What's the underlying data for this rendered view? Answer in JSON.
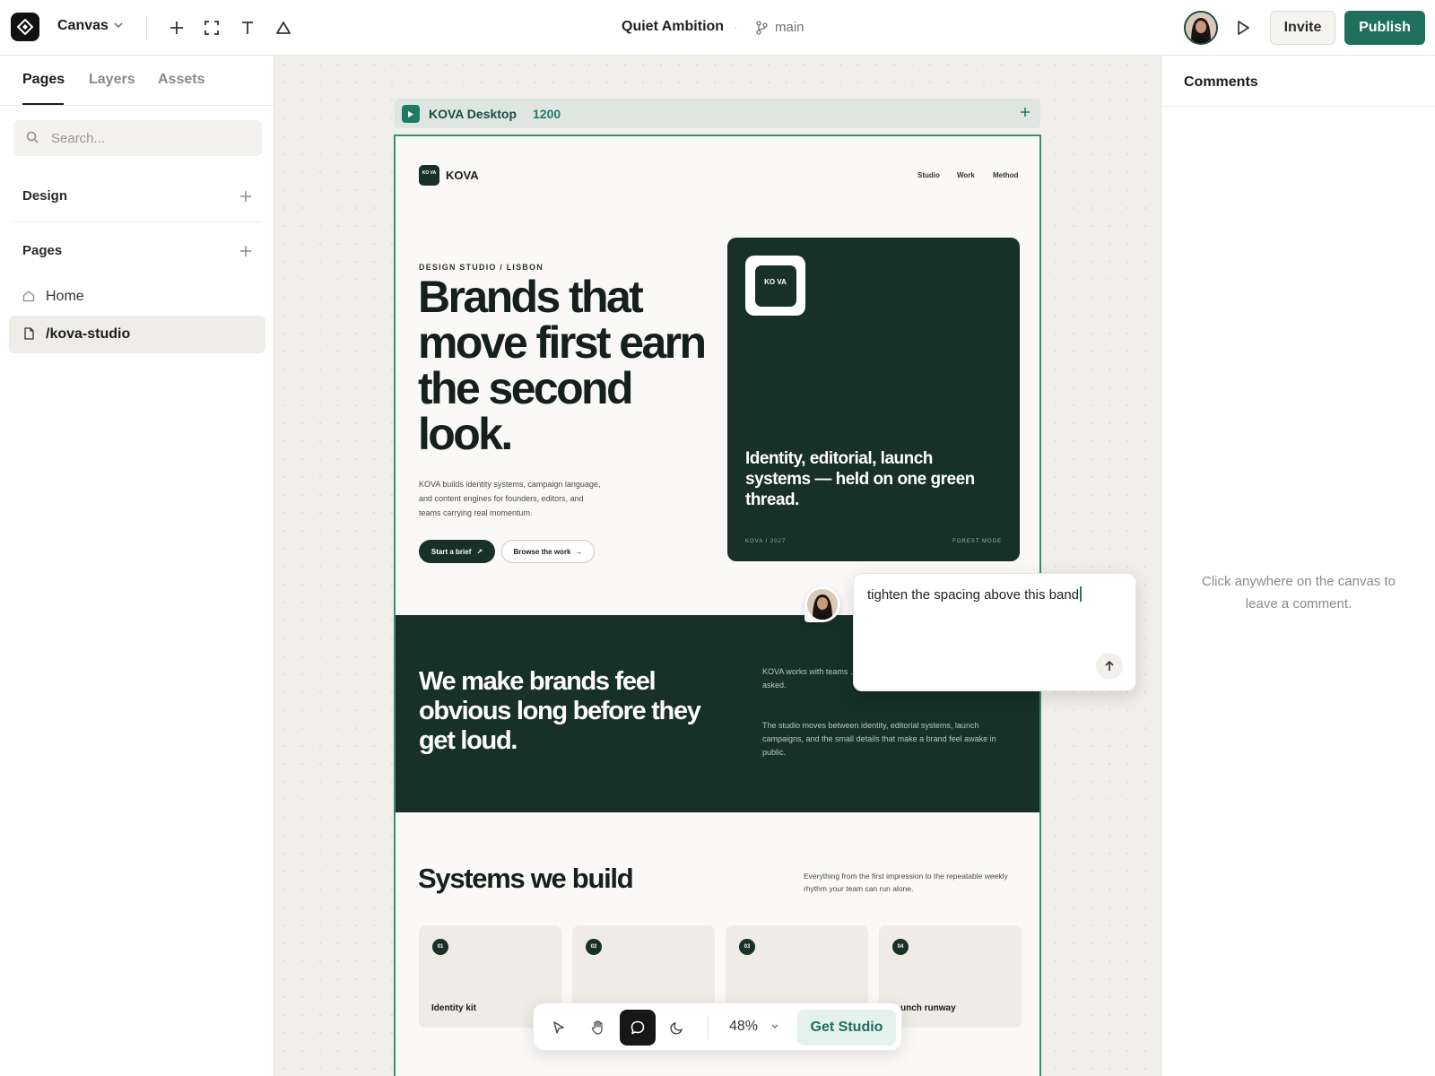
{
  "app": {
    "name": "Canvas",
    "document_title": "Quiet Ambition",
    "branch": "main",
    "invite_label": "Invite",
    "publish_label": "Publish"
  },
  "left_panel": {
    "tabs": [
      {
        "label": "Pages",
        "active": true
      },
      {
        "label": "Layers",
        "active": false
      },
      {
        "label": "Assets",
        "active": false
      }
    ],
    "search_placeholder": "Search...",
    "sections": {
      "design": "Design",
      "pages": "Pages"
    },
    "pages": [
      {
        "label": "Home",
        "icon": "home-icon",
        "active": false
      },
      {
        "label": "/kova-studio",
        "icon": "file-icon",
        "active": true
      }
    ]
  },
  "frame": {
    "name": "KOVA Desktop",
    "width_label": "1200"
  },
  "site": {
    "brand": "KOVA",
    "logo_text": "KO VA",
    "nav": [
      "Studio",
      "Work",
      "Method"
    ],
    "eyebrow": "DESIGN STUDIO / LISBON",
    "headline": "Brands that move first earn the second look.",
    "body": "KOVA builds identity systems, campaign language, and content engines for founders, editors, and teams carrying real momentum.",
    "cta_primary": "Start a brief",
    "cta_secondary": "Browse the work",
    "card": {
      "logo_text": "KO VA",
      "text": "Identity, editorial, launch systems — held on one green thread.",
      "foot_left": "KOVA / 2027",
      "foot_right": "FOREST MODE"
    },
    "band": {
      "headline": "We make brands feel obvious long before they get loud.",
      "para1": "KOVA works with teams … language — then turns th… without being asked.",
      "para2": "The studio moves between identity, editorial systems, launch campaigns, and the small details that make a brand feel awake in public."
    },
    "systems": {
      "title": "Systems we build",
      "subtitle": "Everything from the first impression to the repeatable weekly rhythm your team can run alone.",
      "tiles": [
        {
          "num": "01",
          "label": "Identity kit"
        },
        {
          "num": "02",
          "label": ""
        },
        {
          "num": "03",
          "label": ""
        },
        {
          "num": "04",
          "label": "…unch runway"
        }
      ]
    }
  },
  "comment": {
    "draft": "tighten the spacing above this band"
  },
  "bottom_toolbar": {
    "zoom": "48%",
    "cta": "Get Studio"
  },
  "right_panel": {
    "title": "Comments",
    "empty_text": "Click anywhere on the canvas to leave a comment."
  },
  "colors": {
    "accent": "#1e6f5d",
    "forest": "#173028",
    "frame_outline": "#3d8a77"
  }
}
